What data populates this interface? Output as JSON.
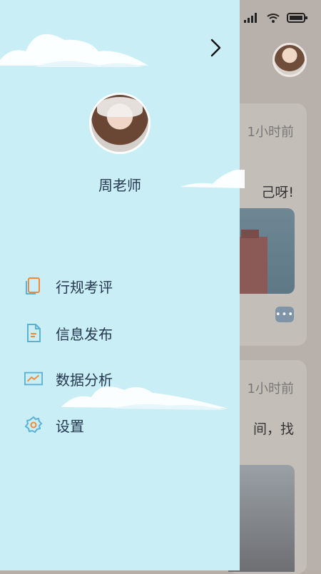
{
  "drawer": {
    "profile": {
      "name": "周老师"
    },
    "menu_items": [
      {
        "label": "行规考评",
        "icon": "document-stack-icon"
      },
      {
        "label": "信息发布",
        "icon": "document-text-icon"
      },
      {
        "label": "数据分析",
        "icon": "chart-icon"
      },
      {
        "label": "设置",
        "icon": "gear-icon"
      }
    ]
  },
  "background": {
    "posts": [
      {
        "time": "1小时前",
        "text": "己呀!"
      },
      {
        "time": "1小时前",
        "text": "间，找"
      }
    ]
  },
  "colors": {
    "drawer_bg": "#c9eef6",
    "menu_text": "#24374f",
    "icon_blue": "#5ab2d6",
    "icon_orange": "#ef8a3a"
  }
}
